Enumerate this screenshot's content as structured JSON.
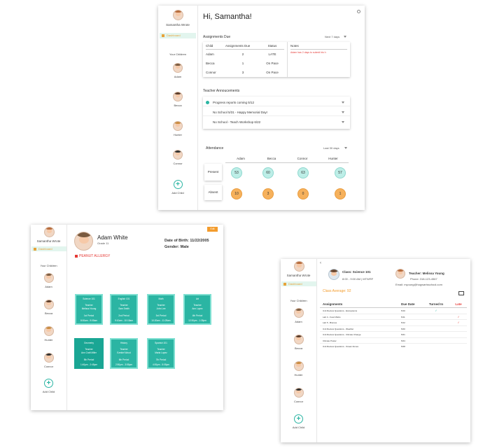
{
  "user": {
    "name": "Samantha Wrote"
  },
  "nav": {
    "dashboard": "Dashboard"
  },
  "your_children": "Your Children",
  "children": [
    "Adam",
    "Becca",
    "Hunter",
    "Connor"
  ],
  "add_child": "Add Child",
  "dashboard": {
    "greeting": "Hi, Samantha!",
    "assignments_due": {
      "title": "Assignments Due",
      "filter": "Next 7 days",
      "headers": [
        "Child",
        "Assignments Due",
        "Status"
      ],
      "rows": [
        [
          "Adam",
          "2",
          "LATE"
        ],
        [
          "Becca",
          "1",
          "On Pace"
        ],
        [
          "Connor",
          "3",
          "On Pace"
        ]
      ],
      "notes_title": "Notes",
      "notes_text": "Adam has 2 days to submit his h"
    },
    "announcements": {
      "title": "Teacher Annoucements",
      "items": [
        "Progress reports coming 5/12",
        "No School 5/31 - Happy Memorial Day!",
        "No School - Teach Workshop 6/22"
      ]
    },
    "attendance": {
      "title": "Attendance",
      "filter": "Last 30 days",
      "names": [
        "Adam",
        "Becca",
        "Connor",
        "Hunter"
      ],
      "present_label": "Present",
      "absent_label": "Absent",
      "present": [
        "53",
        "60",
        "63",
        "57"
      ],
      "absent": [
        "10",
        "3",
        "0",
        "1"
      ]
    }
  },
  "student": {
    "name": "Adam White",
    "grade": "Grade 11",
    "dob": "Date of Birth: 11/22/2005",
    "gender": "Gender: Male",
    "allergy": "PEANUT ALLERGY",
    "edit_button": "Edit",
    "tiles": [
      {
        "title": "Science 101",
        "l2": "Teacher",
        "l3": "Melissa Young",
        "l4": "1st Period",
        "l5": "8:00am - 9:05am"
      },
      {
        "title": "English 101",
        "l2": "Teacher",
        "l3": "Sam Smith",
        "l4": "2nd Period",
        "l5": "9:10am - 10:15am"
      },
      {
        "title": "Math",
        "l2": "Teacher",
        "l3": "John Lee",
        "l4": "3rd Period",
        "l5": "10:20am - 11:25am"
      },
      {
        "title": "Art",
        "l2": "Teacher",
        "l3": "Ann Lopez",
        "l4": "4th Period",
        "l5": "12:30pm - 1:35pm"
      },
      {
        "title": "Geometry",
        "l2": "Teacher",
        "l3": "Ann Craft Miller",
        "l4": "5th Period",
        "l5": "1:40pm - 2:45pm"
      },
      {
        "title": "History",
        "l2": "Teacher",
        "l3": "Ezekiel Wood",
        "l4": "6th Period",
        "l5": "2:50pm - 3:55pm"
      },
      {
        "title": "Spanish 101",
        "l2": "Teacher",
        "l3": "Maria Lopez",
        "l4": "7th Period",
        "l5": "4:00pm - 5:05pm"
      }
    ]
  },
  "class_view": {
    "class_name": "Class: Science 101",
    "schedule": "8:00 - 9:00 AM | MTWRF",
    "teacher": "Teacher: Melissa Young",
    "phone": "Phone: 318-123-4567",
    "email": "Email: myoung@hogwartsschool.com",
    "average": "Class Average: 92",
    "headers": [
      "Assignments",
      "Due Date",
      "Turned In",
      "Late"
    ],
    "rows": [
      {
        "name": "Unit Review Questions - Ecosystems",
        "date": "5/10",
        "turned": "✓",
        "late": ""
      },
      {
        "name": "Lab 4 - Food Webs",
        "date": "5/11",
        "turned": "",
        "late": "✓"
      },
      {
        "name": "Lab 5 - Biomes",
        "date": "5/12",
        "turned": "",
        "late": "✓"
      },
      {
        "name": "Unit Review Questions - Weather",
        "date": "5/20",
        "turned": "",
        "late": ""
      },
      {
        "name": "Unit Review Questions - Climate Change",
        "date": "5/21",
        "turned": "",
        "late": ""
      },
      {
        "name": "Climate Poster",
        "date": "5/24",
        "turned": "",
        "late": ""
      },
      {
        "name": "Unit Review Questions - Ocean Zones",
        "date": "5/28",
        "turned": "",
        "late": ""
      }
    ]
  }
}
